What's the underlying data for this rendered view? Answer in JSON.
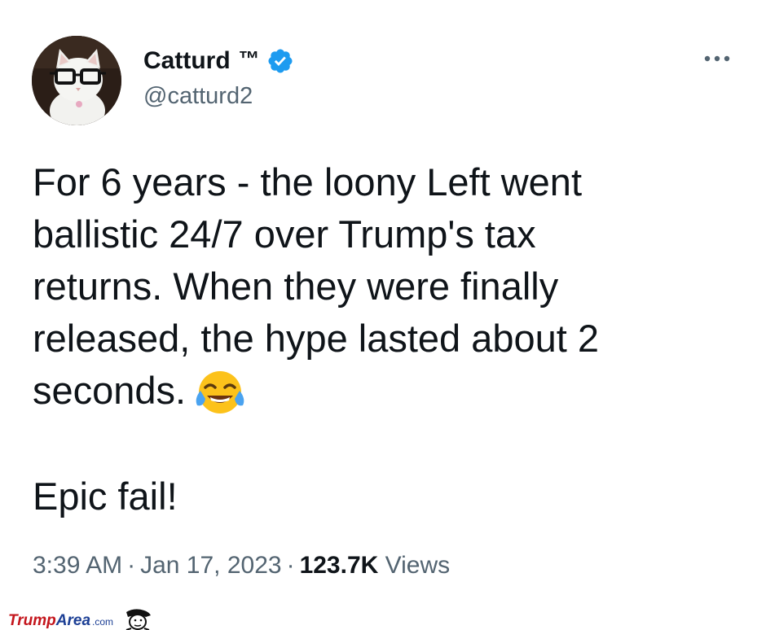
{
  "tweet": {
    "display_name": "Catturd",
    "tm": "™",
    "handle": "@catturd2",
    "text_main": "For 6 years - the loony Left went\nballistic 24/7 over Trump's tax\nreturns. When they were finally\nreleased, the hype lasted about 2\nseconds.",
    "text_end": "Epic fail!",
    "emoji": "face-with-tears-of-joy",
    "time": "3:39 AM",
    "date": "Jan 17, 2023",
    "separator": "·",
    "views_count": "123.7K",
    "views_label": "Views"
  },
  "icons": {
    "verified": "verified-badge-icon",
    "more": "more-options-icon"
  },
  "colors": {
    "verified_blue": "#1d9bf0",
    "text_primary": "#0f1419",
    "text_secondary": "#536471"
  },
  "watermark": {
    "part1": "Trump",
    "part2": "Area",
    "part3": ".com"
  }
}
